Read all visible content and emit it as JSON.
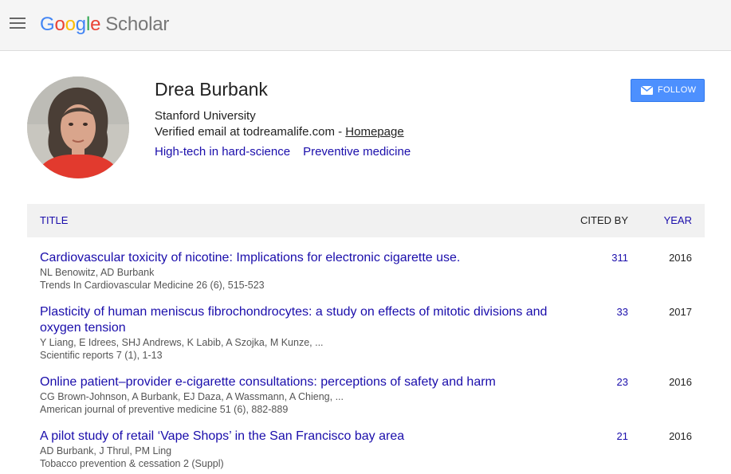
{
  "header": {
    "logo_letters": [
      "G",
      "o",
      "o",
      "g",
      "l",
      "e"
    ],
    "logo_product": "Scholar"
  },
  "profile": {
    "name": "Drea Burbank",
    "affiliation": "Stanford University",
    "email_text": "Verified email at todreamalife.com - ",
    "homepage_label": "Homepage",
    "interests": [
      "High-tech in hard-science",
      "Preventive medicine"
    ],
    "follow_label": "FOLLOW"
  },
  "table": {
    "col_title": "TITLE",
    "col_cited": "CITED BY",
    "col_year": "YEAR",
    "rows": [
      {
        "title": "Cardiovascular toxicity of nicotine: Implications for electronic cigarette use.",
        "authors": "NL Benowitz, AD Burbank",
        "venue": "Trends In Cardiovascular Medicine 26 (6), 515-523",
        "cited": "311",
        "year": "2016"
      },
      {
        "title": "Plasticity of human meniscus fibrochondrocytes: a study on effects of mitotic divisions and oxygen tension",
        "authors": "Y Liang, E Idrees, SHJ Andrews, K Labib, A Szojka, M Kunze, ...",
        "venue": "Scientific reports 7 (1), 1-13",
        "cited": "33",
        "year": "2017"
      },
      {
        "title": "Online patient–provider e-cigarette consultations: perceptions of safety and harm",
        "authors": "CG Brown-Johnson, A Burbank, EJ Daza, A Wassmann, A Chieng, ...",
        "venue": "American journal of preventive medicine 51 (6), 882-889",
        "cited": "23",
        "year": "2016"
      },
      {
        "title": "A pilot study of retail ‘Vape Shops’ in the San Francisco bay area",
        "authors": "AD Burbank, J Thrul, PM Ling",
        "venue": "Tobacco prevention & cessation 2 (Suppl)",
        "cited": "21",
        "year": "2016"
      }
    ]
  }
}
